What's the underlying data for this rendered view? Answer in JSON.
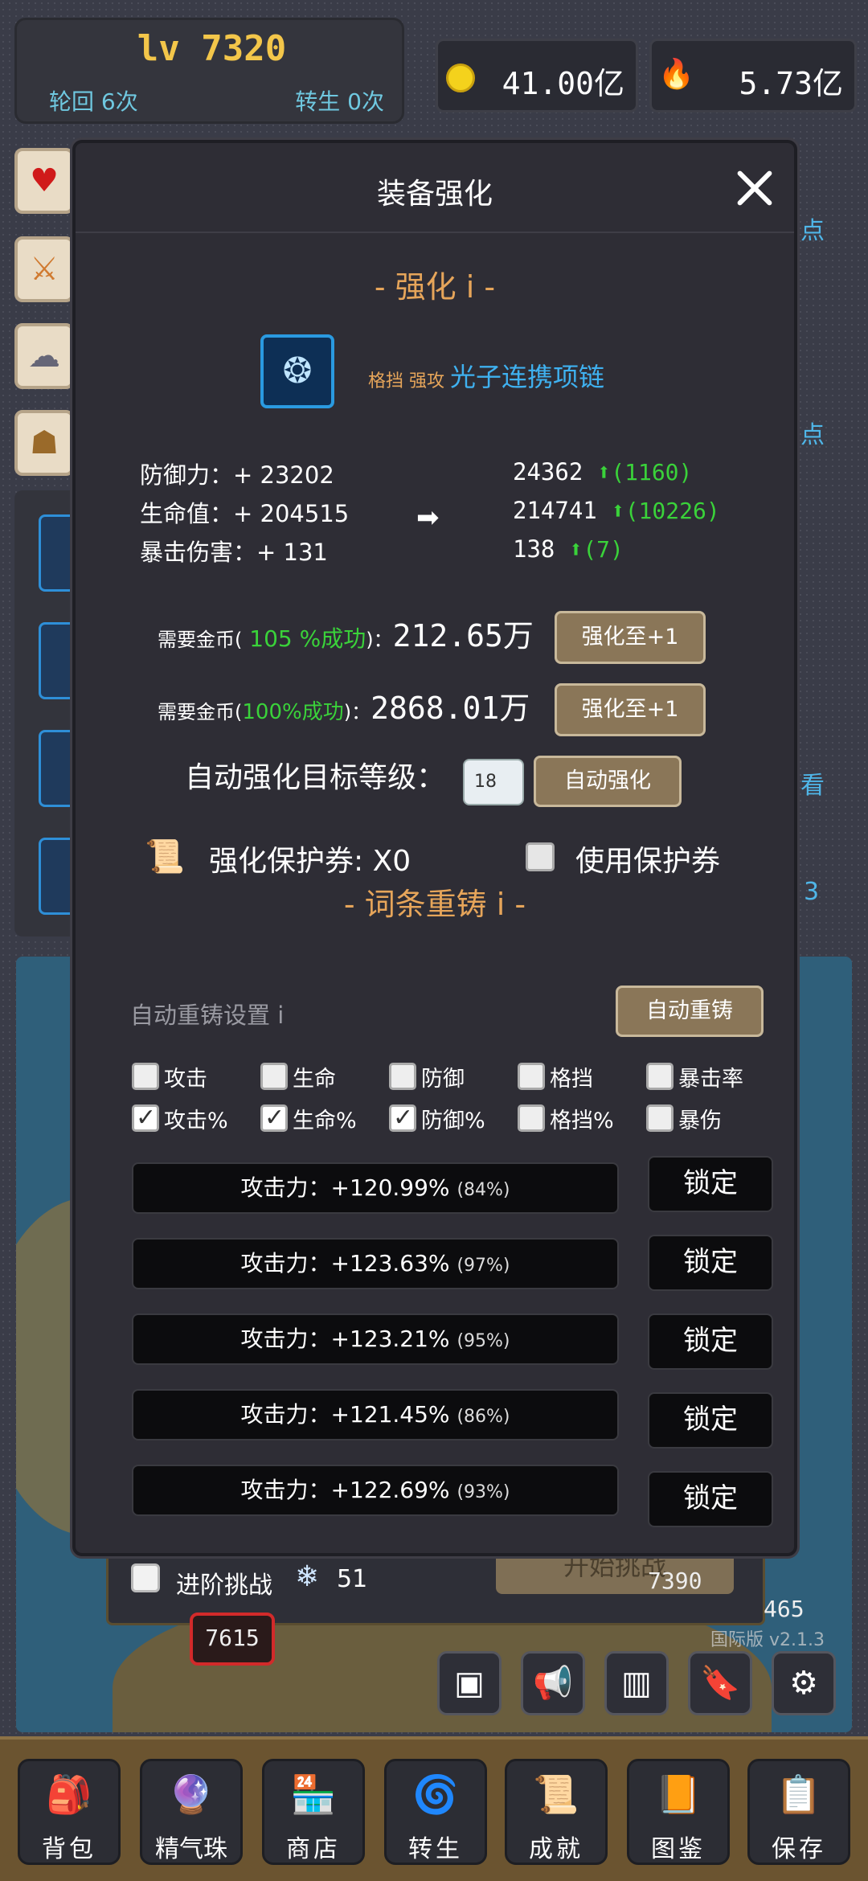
{
  "header": {
    "level": "lv 7320",
    "rebirth": "轮回 6次",
    "reincarnate": "转生 0次",
    "gold": "41.00亿",
    "fire": "5.73亿"
  },
  "background": {
    "right_texts": [
      "点",
      "点",
      "看",
      "3"
    ],
    "enemy_power_1": "7615",
    "enemy_power_2": "7390",
    "enemy_power_3": "465",
    "version": "国际版 v2.1.3",
    "advanced_challenge_label": "进阶挑战",
    "advanced_challenge_count": "51",
    "start_challenge_label": "开始挑战"
  },
  "nav": [
    {
      "label": "背包",
      "icon": "backpack-icon"
    },
    {
      "label": "精气珠",
      "icon": "orb-icon"
    },
    {
      "label": "商店",
      "icon": "shop-icon"
    },
    {
      "label": "转生",
      "icon": "rebirth-icon"
    },
    {
      "label": "成就",
      "icon": "achievement-icon"
    },
    {
      "label": "图鉴",
      "icon": "codex-icon"
    },
    {
      "label": "保存",
      "icon": "save-icon"
    }
  ],
  "modal": {
    "title": "装备强化",
    "enhance_section": "- 强化 i -",
    "item": {
      "tags": "格挡 强攻",
      "name": "光子连携项链"
    },
    "stats": [
      {
        "label": "防御力：+ 23202",
        "new": "24362",
        "gain": "(1160)"
      },
      {
        "label": "生命值：+ 204515",
        "new": "214741",
        "gain": "(10226)"
      },
      {
        "label": "暴击伤害：+ 131",
        "new": "138",
        "gain": "(7)"
      }
    ],
    "costs": [
      {
        "prefix": "需要金币(",
        "rate": " 105 %成功",
        "suffix": ")：",
        "amount": "212.65万",
        "button": "强化至+1"
      },
      {
        "prefix": "需要金币(",
        "rate": "100%成功",
        "suffix": ")：",
        "amount": "2868.01万",
        "button": "强化至+1"
      }
    ],
    "auto_target_label": "自动强化目标等级：",
    "auto_target_value": "18",
    "auto_enhance_button": "自动强化",
    "protect_ticket_label": "强化保护券: X0",
    "use_ticket_label": "使用保护券",
    "reforge_section": "- 词条重铸 i -",
    "auto_reforge_label": "自动重铸设置 i",
    "auto_reforge_button": "自动重铸",
    "filters_row1": [
      {
        "label": "攻击",
        "checked": false
      },
      {
        "label": "生命",
        "checked": false
      },
      {
        "label": "防御",
        "checked": false
      },
      {
        "label": "格挡",
        "checked": false
      },
      {
        "label": "暴击率",
        "checked": false
      }
    ],
    "filters_row2": [
      {
        "label": "攻击%",
        "checked": true
      },
      {
        "label": "生命%",
        "checked": true
      },
      {
        "label": "防御%",
        "checked": true
      },
      {
        "label": "格挡%",
        "checked": false
      },
      {
        "label": "暴伤",
        "checked": false
      }
    ],
    "affixes": [
      {
        "text": "攻击力：+120.99%",
        "pct": "(84%)",
        "lock": "锁定"
      },
      {
        "text": "攻击力：+123.63%",
        "pct": "(97%)",
        "lock": "锁定"
      },
      {
        "text": "攻击力：+123.21%",
        "pct": "(95%)",
        "lock": "锁定"
      },
      {
        "text": "攻击力：+121.45%",
        "pct": "(86%)",
        "lock": "锁定"
      },
      {
        "text": "攻击力：+122.69%",
        "pct": "(93%)",
        "lock": "锁定"
      }
    ]
  }
}
